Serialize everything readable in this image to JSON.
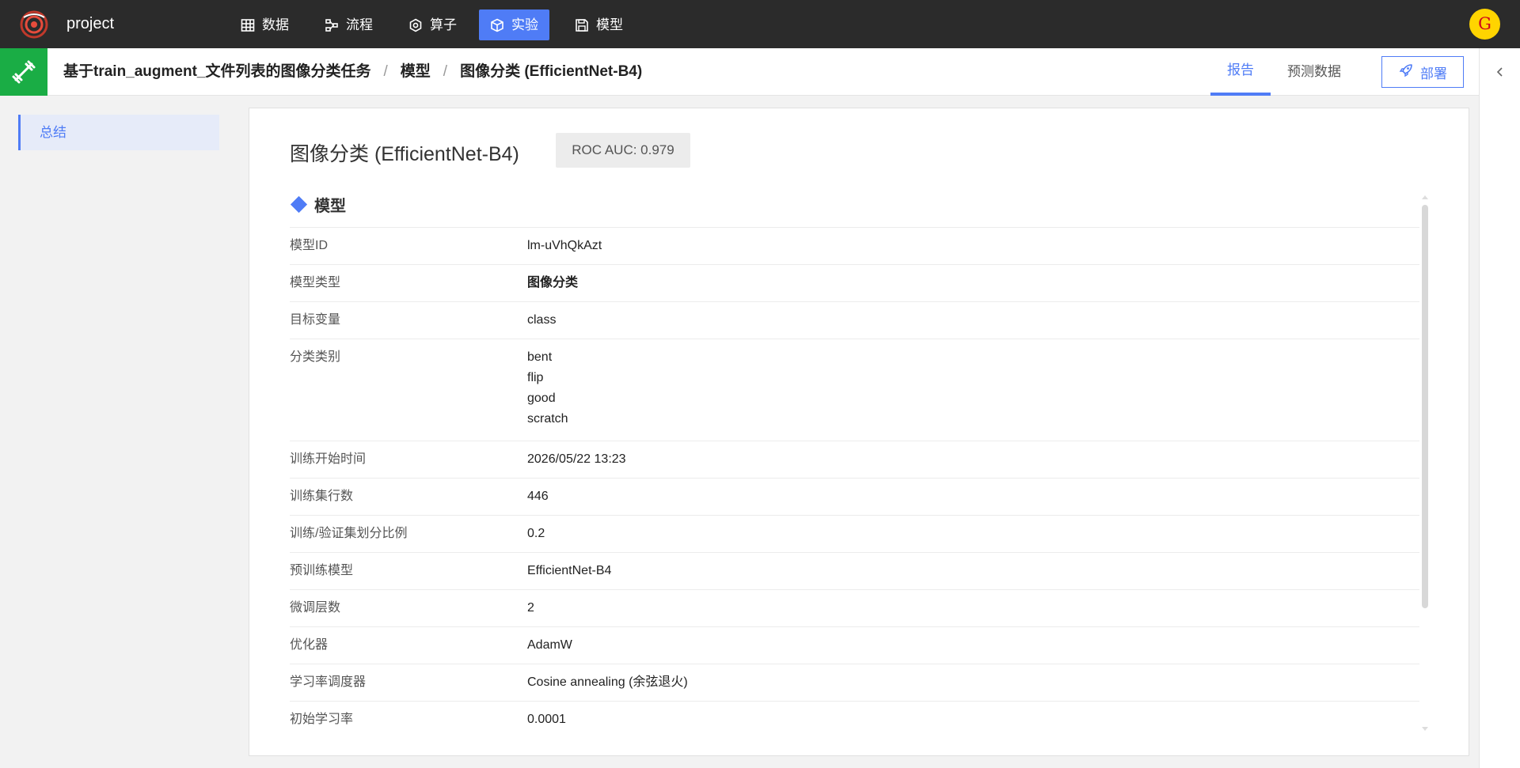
{
  "header": {
    "app_name": "project",
    "nav": [
      {
        "label": "数据",
        "icon": "table-icon"
      },
      {
        "label": "流程",
        "icon": "flow-icon"
      },
      {
        "label": "算子",
        "icon": "hexagon-icon"
      },
      {
        "label": "实验",
        "icon": "cube-icon",
        "active": true
      },
      {
        "label": "模型",
        "icon": "save-icon"
      }
    ],
    "avatar_letter": "G"
  },
  "subheader": {
    "breadcrumb": [
      "基于train_augment_文件列表的图像分类任务",
      "模型",
      "图像分类 (EfficientNet-B4)"
    ],
    "separator": "/",
    "tabs": [
      {
        "label": "报告",
        "active": true
      },
      {
        "label": "预测数据",
        "active": false
      }
    ],
    "deploy_label": "部署"
  },
  "sidebar": {
    "items": [
      {
        "label": "总结",
        "active": true
      }
    ]
  },
  "main": {
    "title": "图像分类 (EfficientNet-B4)",
    "metric_badge": "ROC AUC: 0.979",
    "section_title": "模型",
    "rows": [
      {
        "key": "模型ID",
        "value": "lm-uVhQkAzt"
      },
      {
        "key": "模型类型",
        "value": "图像分类"
      },
      {
        "key": "目标变量",
        "value": "class"
      },
      {
        "key": "分类类别",
        "values": [
          "bent",
          "flip",
          "good",
          "scratch"
        ]
      },
      {
        "key": "训练开始时间",
        "value": "2026/05/22 13:23"
      },
      {
        "key": "训练集行数",
        "value": "446"
      },
      {
        "key": "训练/验证集划分比例",
        "value": "0.2"
      },
      {
        "key": "预训练模型",
        "value": "EfficientNet-B4"
      },
      {
        "key": "微调层数",
        "value": "2"
      },
      {
        "key": "优化器",
        "value": "AdamW"
      },
      {
        "key": "学习率调度器",
        "value": "Cosine annealing (余弦退火)"
      },
      {
        "key": "初始学习率",
        "value": "0.0001"
      }
    ]
  },
  "colors": {
    "accent": "#4f7cf6",
    "topbar": "#2b2b2b",
    "sub_icon_bg": "#1aad45",
    "avatar_bg": "#ffd400"
  }
}
